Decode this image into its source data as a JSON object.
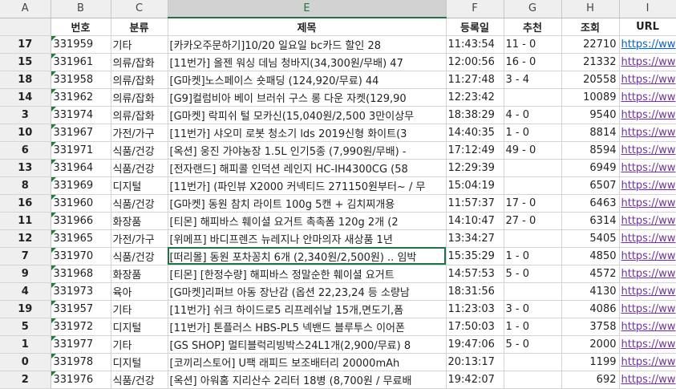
{
  "columns": [
    "A",
    "B",
    "C",
    "E",
    "F",
    "G",
    "H",
    "I"
  ],
  "header": {
    "no": "번호",
    "cat": "분류",
    "title": "제목",
    "time": "등록일",
    "rec": "추천",
    "views": "조회",
    "url": "URL"
  },
  "rows": [
    {
      "row": "17",
      "no": "331959",
      "cat": "기타",
      "title": " [카카오주문하기]10/20 일요일 bc카드 할인 28",
      "time": "11:43:54",
      "rec": "11 - 0",
      "views": "22710",
      "url": "https://ww"
    },
    {
      "row": "15",
      "no": "331961",
      "cat": "의류/잡화",
      "title": " [11번가] 올젠 워싱 데님 청바지(34,300원/무배) 47",
      "time": "12:00:56",
      "rec": "16 - 0",
      "views": "21332",
      "url": "https://ww"
    },
    {
      "row": "18",
      "no": "331958",
      "cat": "의류/잡화",
      "title": "[G마켓]노스페이스 숏패딩 (124,920/무료) 44",
      "time": "11:27:48",
      "rec": "3 - 4",
      "views": "20558",
      "url": "https://ww"
    },
    {
      "row": "14",
      "no": "331962",
      "cat": "의류/잡화",
      "title": "[G9]컬럼비아 베이 브러쉬 구스 롱 다운 자켓(129,90",
      "time": "12:23:42",
      "rec": "",
      "views": "10089",
      "url": "https://ww"
    },
    {
      "row": "3",
      "no": "331974",
      "cat": "의류/잡화",
      "title": "[G마켓] 락피쉬 털 모카신(15,040원/2,500 3만이상무",
      "time": "18:38:29",
      "rec": "4 - 0",
      "views": "9540",
      "url": "https://ww"
    },
    {
      "row": "10",
      "no": "331967",
      "cat": "가전/가구",
      "title": "[11번가] 샤오미 로봇 청소기 lds 2019신형 화이트(3",
      "time": "14:40:35",
      "rec": "1 - 0",
      "views": "8814",
      "url": "https://ww"
    },
    {
      "row": "6",
      "no": "331971",
      "cat": "식품/건강",
      "title": " [옥션] 웅진 가야농장 1.5L 인기5종 (7,990원/무배) -",
      "time": "17:12:49",
      "rec": "49 - 0",
      "views": "8594",
      "url": "https://ww"
    },
    {
      "row": "13",
      "no": "331964",
      "cat": "식품/건강",
      "title": "[전자랜드] 해피콜 인덕션 레인지 HC-IH4300CG (58",
      "time": "12:29:39",
      "rec": "",
      "views": "6949",
      "url": "https://ww"
    },
    {
      "row": "8",
      "no": "331969",
      "cat": "디지털",
      "title": "[11번가] (파인뷰 X2000 커넥티드 271150원부터~ / 무",
      "time": "15:04:19",
      "rec": "",
      "views": "6507",
      "url": "https://ww"
    },
    {
      "row": "16",
      "no": "331960",
      "cat": "식품/건강",
      "title": " [G마켓] 동원 참치 라이트 100g 5캔 + 김치찌개용",
      "time": "11:57:37",
      "rec": "17 - 0",
      "views": "6463",
      "url": "https://ww"
    },
    {
      "row": "11",
      "no": "331966",
      "cat": "화장품",
      "title": " [티몬] 해피바스 훼이셜 요거트 촉촉폼 120g 2개 (2",
      "time": "14:10:47",
      "rec": "27 - 0",
      "views": "6314",
      "url": "https://ww"
    },
    {
      "row": "12",
      "no": "331965",
      "cat": "가전/가구",
      "title": "[위메프] 바디프렌즈 뉴레지나 안마의자 새상품 1년",
      "time": "13:34:27",
      "rec": "",
      "views": "5405",
      "url": "https://ww"
    },
    {
      "row": "7",
      "no": "331970",
      "cat": "식품/건강",
      "title": "[떠리몰] 동원 포차꽁치 6개 (2,340원/2,500원) .. 임박",
      "time": "15:35:29",
      "rec": "1 - 0",
      "views": "4850",
      "url": "https://ww"
    },
    {
      "row": "9",
      "no": "331968",
      "cat": "화장품",
      "title": "[티몬] [한정수량] 해피바스 정말순한 훼이셜 요거트",
      "time": "14:57:53",
      "rec": "5 - 0",
      "views": "4572",
      "url": "https://ww"
    },
    {
      "row": "4",
      "no": "331973",
      "cat": "육아",
      "title": "[G마켓]리퍼브 아동 장난감 (옵션 22,23,24 등 소량남",
      "time": "18:31:56",
      "rec": "",
      "views": "4130",
      "url": "https://ww"
    },
    {
      "row": "19",
      "no": "331957",
      "cat": "기타",
      "title": "[11번가] 쉬크 하이드로5 리프레쉬날 15개,면도기,폼",
      "time": "11:23:03",
      "rec": "3 - 0",
      "views": "4086",
      "url": "https://ww"
    },
    {
      "row": "5",
      "no": "331972",
      "cat": "디지털",
      "title": "[11번가] 톤플러스 HBS-PL5 넥밴드 블루투스 이어폰",
      "time": "17:50:03",
      "rec": "1 - 0",
      "views": "3758",
      "url": "https://ww"
    },
    {
      "row": "1",
      "no": "331977",
      "cat": "기타",
      "title": "[GS SHOP] 멀티블럭리빙박스24L1개(2,900/무료) 8",
      "time": "19:47:06",
      "rec": "5 - 0",
      "views": "2000",
      "url": "https://ww"
    },
    {
      "row": "0",
      "no": "331978",
      "cat": "디지털",
      "title": "[코끼리스토어] U팩 래피드 보조배터리 20000mAh",
      "time": "20:13:17",
      "rec": "",
      "views": "1199",
      "url": "https://ww"
    },
    {
      "row": "2",
      "no": "331976",
      "cat": "식품/건강",
      "title": "[옥션] 아워홈 지리산수 2리터 18병 (8,700원 / 무료배",
      "time": "19:42:07",
      "rec": "",
      "views": "692",
      "url": "https://ww"
    }
  ]
}
